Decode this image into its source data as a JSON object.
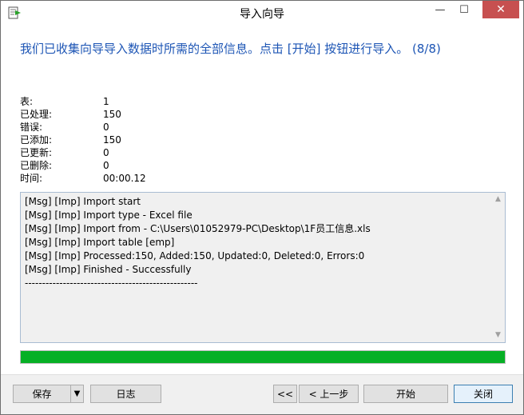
{
  "window": {
    "title": "导入向导",
    "min_glyph": "—",
    "max_glyph": "☐",
    "close_glyph": "✕"
  },
  "heading": "我们已收集向导导入数据时所需的全部信息。点击 [开始] 按钮进行导入。 (8/8)",
  "stats": [
    {
      "label": "表:",
      "value": "1"
    },
    {
      "label": "已处理:",
      "value": "150"
    },
    {
      "label": "错误:",
      "value": "0"
    },
    {
      "label": "已添加:",
      "value": "150"
    },
    {
      "label": "已更新:",
      "value": "0"
    },
    {
      "label": "已删除:",
      "value": "0"
    },
    {
      "label": "时间:",
      "value": "00:00.12"
    }
  ],
  "log": {
    "lines": [
      "[Msg] [Imp] Import start",
      "[Msg] [Imp] Import type - Excel file",
      "[Msg] [Imp] Import from - C:\\Users\\01052979-PC\\Desktop\\1F员工信息.xls",
      "[Msg] [Imp] Import table [emp]",
      "[Msg] [Imp] Processed:150, Added:150, Updated:0, Deleted:0, Errors:0",
      "[Msg] [Imp] Finished - Successfully",
      "--------------------------------------------------"
    ]
  },
  "progress": {
    "fraction": 1.0,
    "color": "#06b025"
  },
  "buttons": {
    "save": "保存",
    "save_dropdown": "▼",
    "log": "日志",
    "first": "<<",
    "prev": "< 上一步",
    "start": "开始",
    "close": "关闭"
  },
  "colors": {
    "heading": "#1e56b5",
    "close_button": "#c75050"
  }
}
